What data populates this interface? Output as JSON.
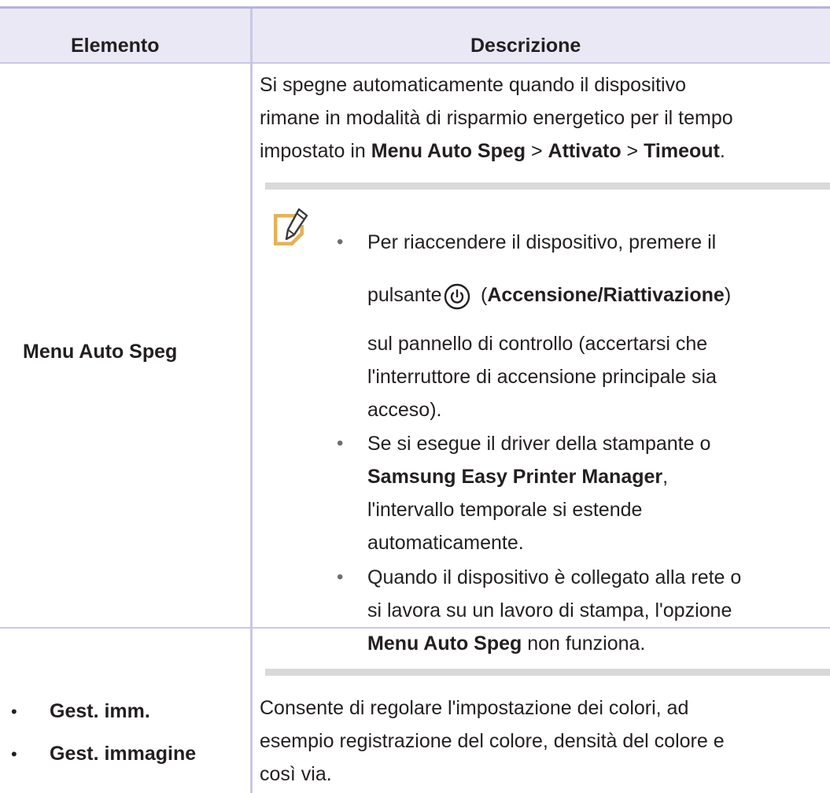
{
  "table": {
    "headers": {
      "element": "Elemento",
      "description": "Descrizione"
    },
    "rows": [
      {
        "element": "Menu Auto Speg",
        "description": {
          "line1": "Si spegne automaticamente quando il dispositivo",
          "line2": "rimane in modalità di risparmio energetico per il tempo",
          "line3_prefix": "impostato in ",
          "path": [
            "Menu Auto Speg",
            "Attivato",
            "Timeout"
          ],
          "path_sep": " > ",
          "line3_suffix": "."
        },
        "note": {
          "icon": "note-pencil-icon",
          "bullets": [
            {
              "line1": "Per riaccendere il dispositivo, premere il",
              "line2_prefix": "pulsante",
              "button_icon": "power-icon",
              "button_label": "Accensione/Riattivazione",
              "line3": "sul pannello di controllo (accertarsi che",
              "line4": "l'interruttore di accensione principale sia",
              "line5": "acceso)."
            },
            {
              "line1": "Se si esegue il driver della stampante o",
              "line2_bold": "Samsung Easy Printer Manager",
              "line2_suffix": ",",
              "line3": "l'intervallo temporale si estende",
              "line4": "automaticamente."
            },
            {
              "line1": "Quando il dispositivo è collegato alla rete o",
              "line2": "si lavora su un lavoro di stampa, l'opzione",
              "line3_bold": "Menu Auto Speg",
              "line3_suffix": " non funziona."
            }
          ]
        }
      },
      {
        "element_items": [
          "Gest. imm.",
          "Gest. immagine"
        ],
        "description": {
          "line1": "Consente di regolare l'impostazione dei colori, ad",
          "line2": "esempio registrazione del colore, densità del colore e",
          "line3": "così via."
        }
      }
    ]
  },
  "colors": {
    "header_bg": "#e9e8f4",
    "rule": "#b6b3d9",
    "grid": "#c9c7e3",
    "note_bar": "#d9d9d9",
    "icon_accent": "#e3b25a"
  }
}
